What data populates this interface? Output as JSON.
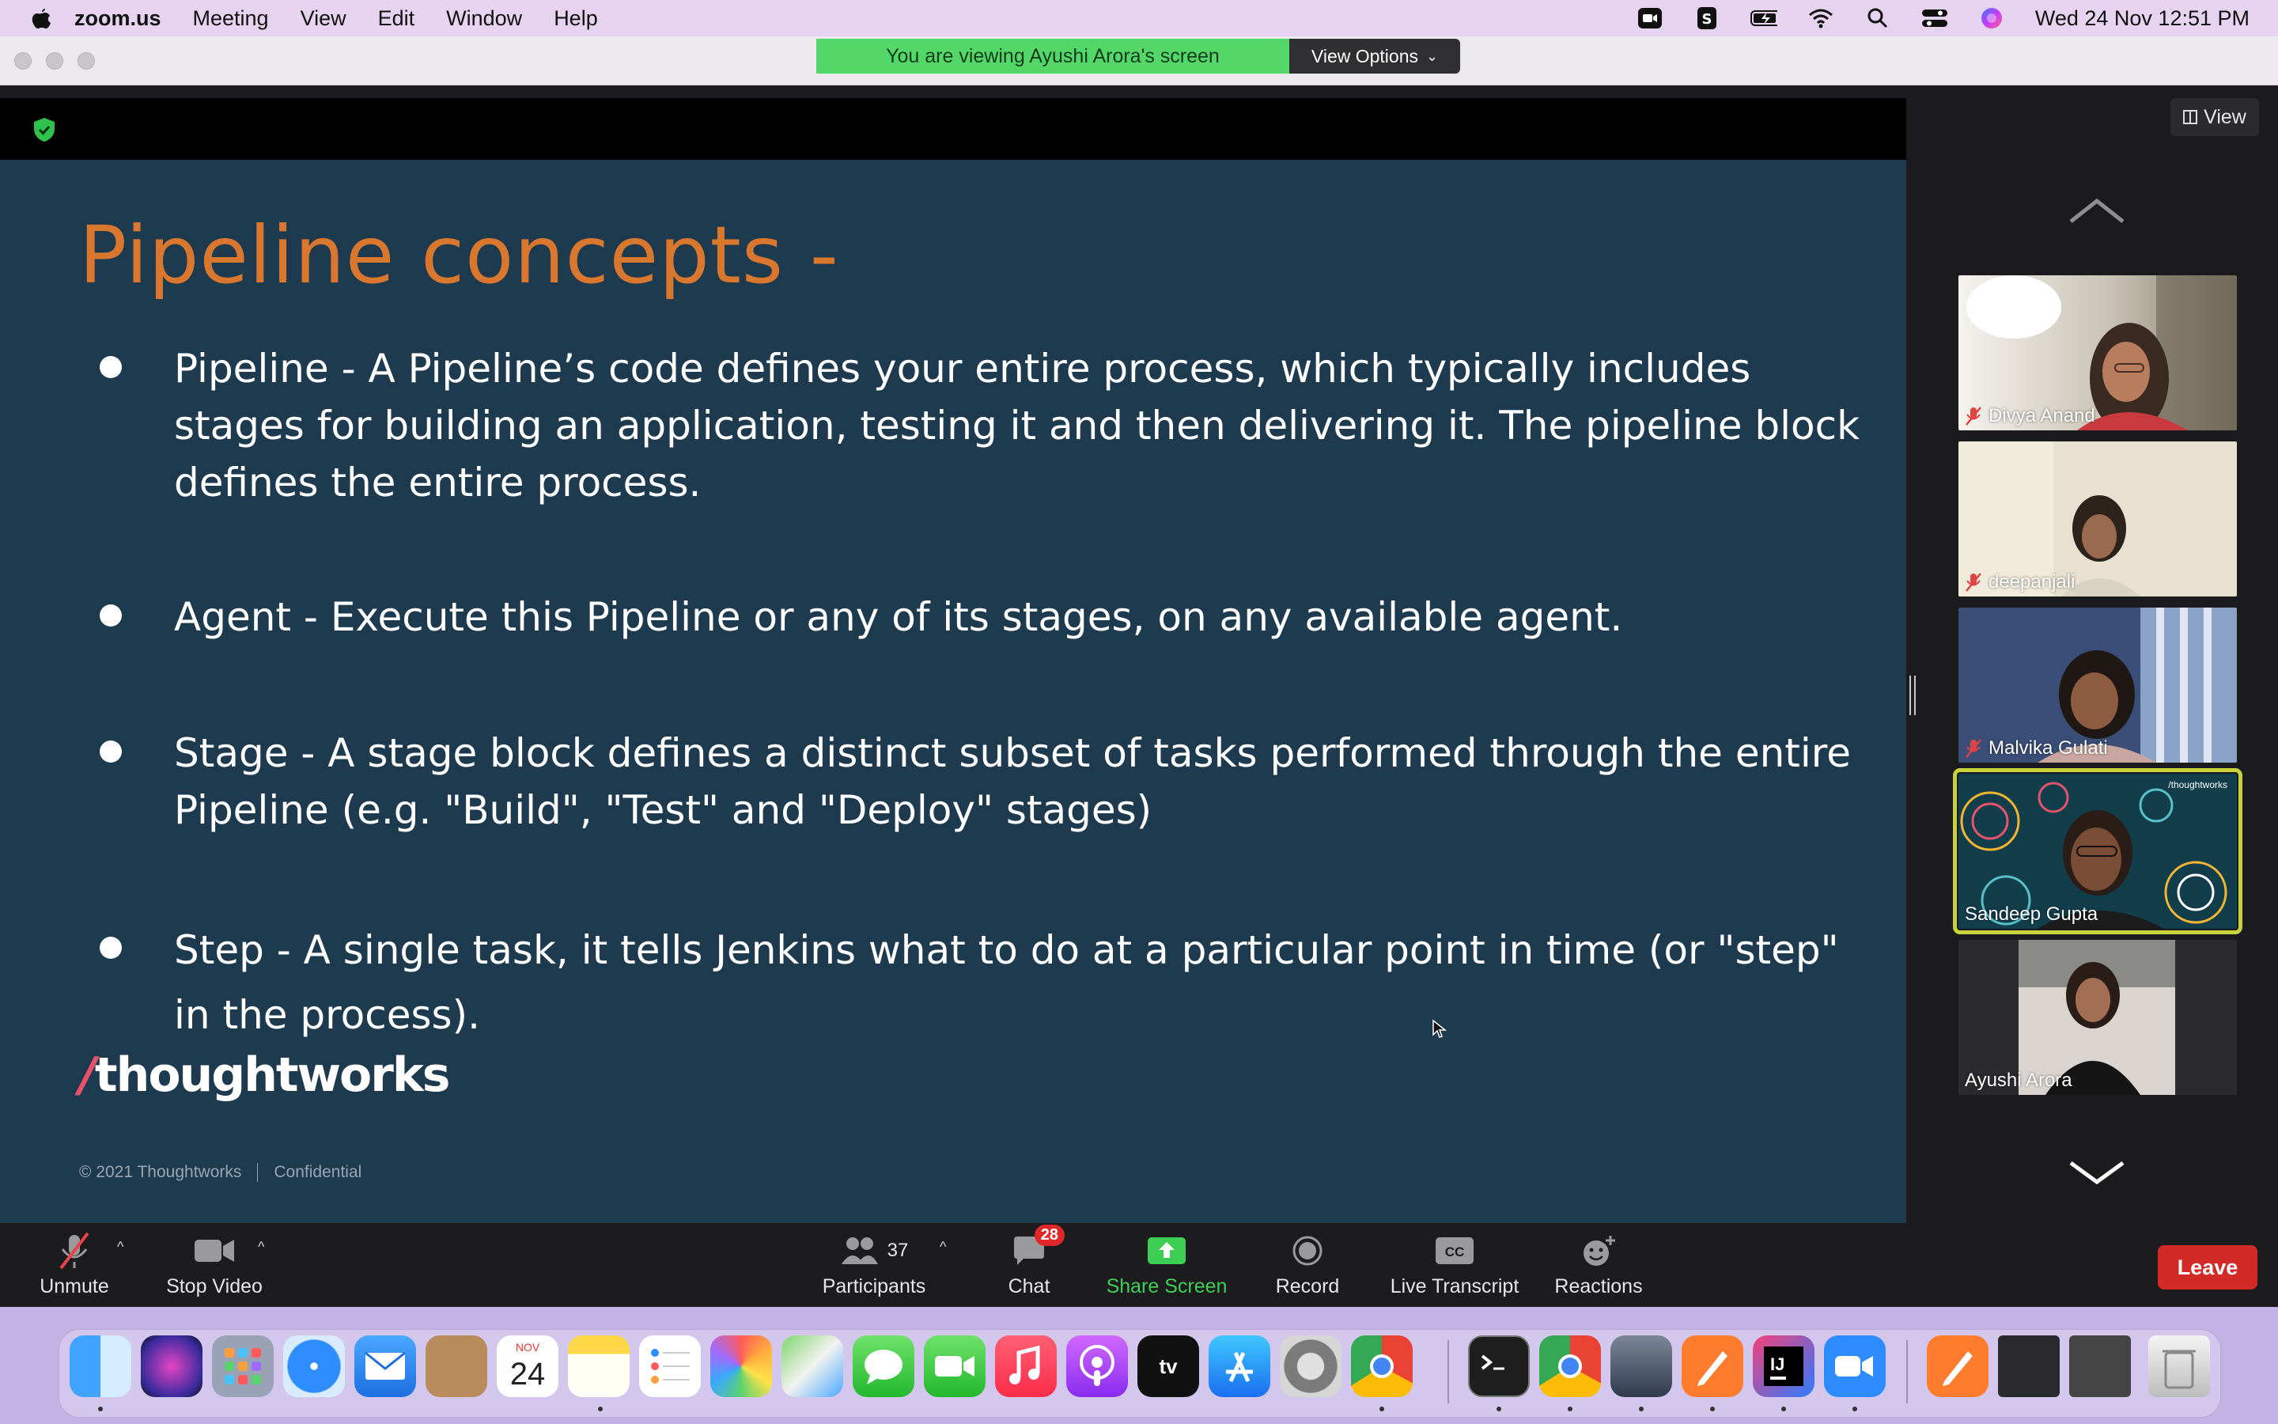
{
  "menubar": {
    "app_name": "zoom.us",
    "menus": [
      "Meeting",
      "View",
      "Edit",
      "Window",
      "Help"
    ],
    "clock": "Wed 24 Nov  12:51 PM"
  },
  "banner": {
    "viewing_text": "You are viewing Ayushi Arora's screen",
    "view_options": "View Options"
  },
  "slide": {
    "title": "Pipeline concepts -",
    "bullets": [
      "Pipeline - A Pipeline’s code defines your entire process, which typically includes stages for building an application, testing it and then delivering it. The pipeline block  defines the entire process.",
      "Agent - Execute this Pipeline or any of its stages, on any available agent.",
      "Stage - A stage block defines a distinct subset of tasks performed through the entire Pipeline (e.g. \"Build\", \"Test\" and \"Deploy\" stages)",
      "Step - A single task, it tells Jenkins what to do at a particular point in time (or \"step\" in the process)."
    ],
    "logo_slash": "/",
    "logo_text": "thoughtworks",
    "footer_copyright": "© 2021 Thoughtworks",
    "footer_confidential": "Confidential"
  },
  "panel": {
    "view_label": "View",
    "participants": [
      {
        "name": "Divya Anand",
        "muted": true
      },
      {
        "name": "deepanjali",
        "muted": true
      },
      {
        "name": "Malvika Gulati",
        "muted": true
      },
      {
        "name": "Sandeep Gupta",
        "muted": false
      },
      {
        "name": "Ayushi Arora",
        "muted": false
      }
    ],
    "tile_logo": "/thoughtworks"
  },
  "toolbar": {
    "unmute": "Unmute",
    "stop_video": "Stop Video",
    "participants": "Participants",
    "participant_count": "37",
    "chat": "Chat",
    "chat_badge": "28",
    "share_screen": "Share Screen",
    "record": "Record",
    "live_transcript": "Live Transcript",
    "cc": "CC",
    "reactions": "Reactions",
    "leave": "Leave"
  },
  "dock": {
    "calendar_month": "NOV",
    "calendar_day": "24",
    "tv_label": "tv",
    "intellij_label": "IJ"
  },
  "colors": {
    "slide_bg": "#1e3a4f",
    "slide_title": "#d9772f",
    "banner_green": "#53d769",
    "leave_red": "#d12a27",
    "share_green": "#3ccf54",
    "active_speaker": "#c7d33a"
  }
}
